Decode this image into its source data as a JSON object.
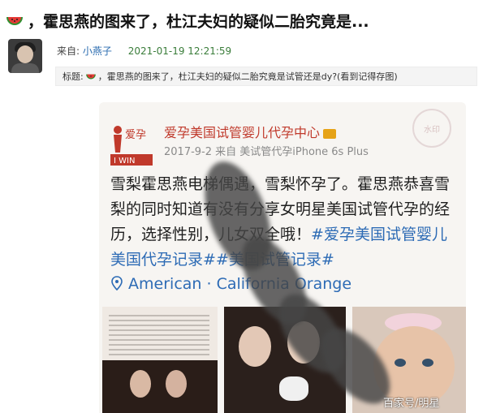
{
  "header": {
    "title": "，霍思燕的图来了，杜江夫妇的疑似二胎究竟是..."
  },
  "meta": {
    "from_label": "来自:",
    "author": "小燕子",
    "datetime": "2021-01-19 12:21:59"
  },
  "subject": {
    "label": "标题:",
    "text": "，霍思燕的图来了，杜江夫妇的疑似二胎究竟是试管还是dy?(看到记得存图)"
  },
  "post": {
    "logo_text_top": "爱孕",
    "logo_text_bottom": "I WIN",
    "brand": "爱孕美国试管婴儿代孕中心",
    "post_meta": "2017-9-2 来自 美试管代孕iPhone 6s Plus",
    "stamp": "水印",
    "body_line1": "雪梨霍思燕电梯偶遇，雪梨怀孕了。霍思燕恭喜雪梨的同时",
    "body_line2": "知道有没有分享女明星美国试管代孕的经历，",
    "body_line3": "选择性别，儿女双全哦！",
    "tag1": "#爱孕美国试管婴儿",
    "tag2": "美国代孕记录##美国试管记录#",
    "location": "American · California Orange"
  },
  "watermark": "百家号/明星",
  "colors": {
    "link": "#2b6cb0",
    "date": "#3a7d3a",
    "tag": "#2d6bb5",
    "brand": "#c0392b"
  }
}
